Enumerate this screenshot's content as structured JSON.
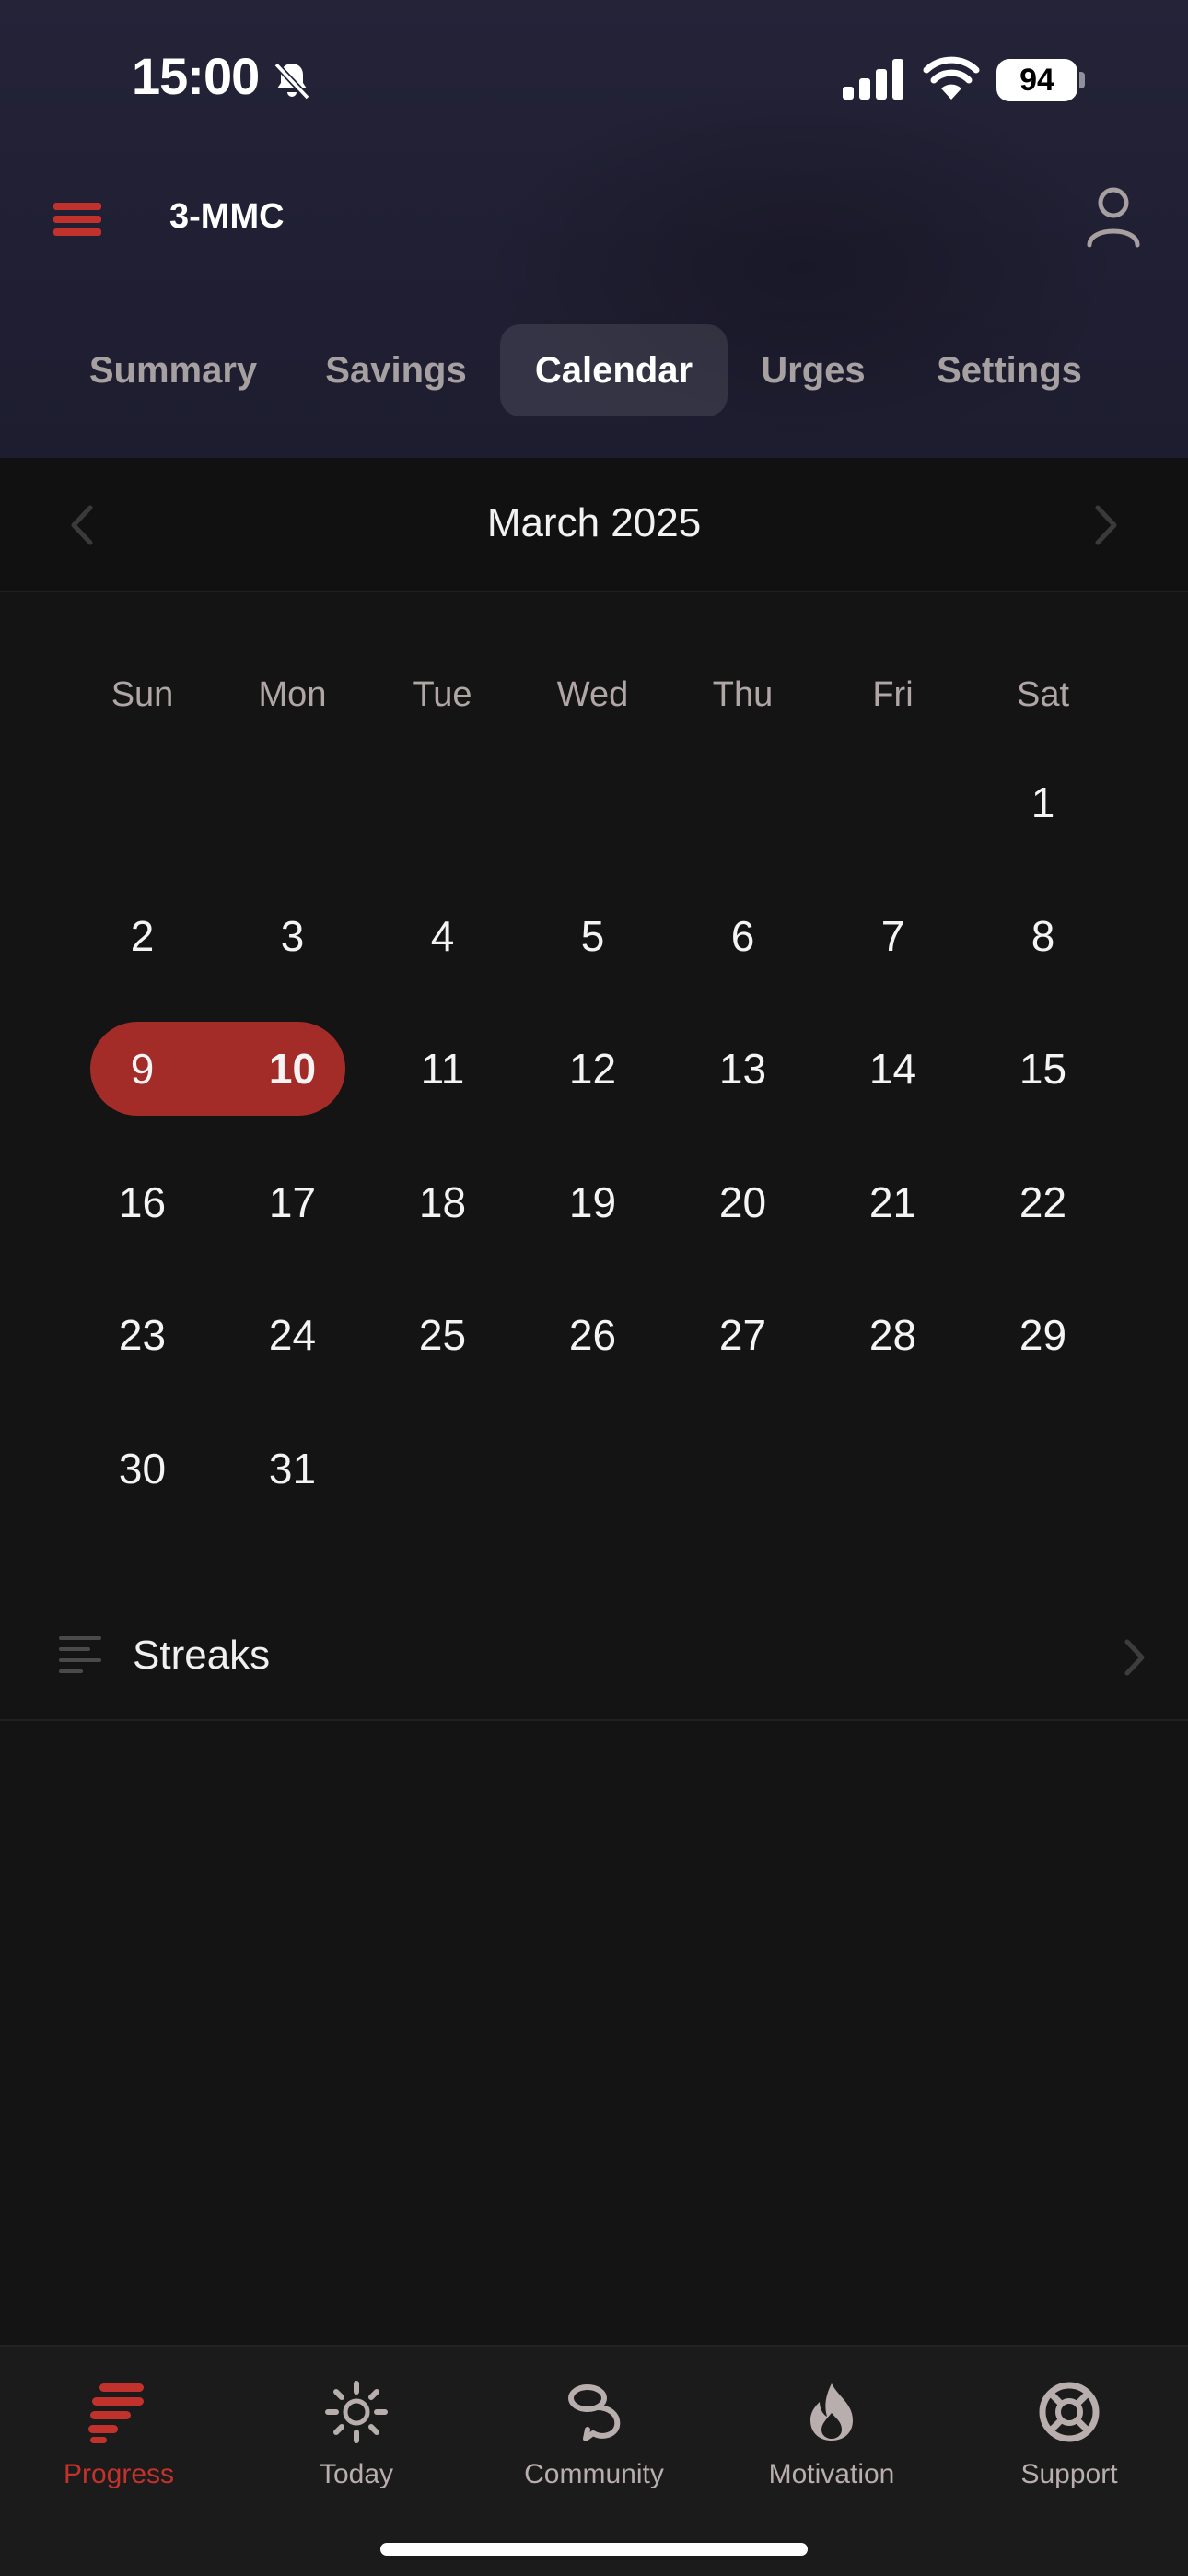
{
  "status_bar": {
    "time": "15:00",
    "battery": "94"
  },
  "header": {
    "title": "3-MMC"
  },
  "tabs": [
    {
      "label": "Summary",
      "active": false
    },
    {
      "label": "Savings",
      "active": false
    },
    {
      "label": "Calendar",
      "active": true
    },
    {
      "label": "Urges",
      "active": false
    },
    {
      "label": "Settings",
      "active": false
    }
  ],
  "calendar": {
    "month_title": "March 2025",
    "weekdays": [
      "Sun",
      "Mon",
      "Tue",
      "Wed",
      "Thu",
      "Fri",
      "Sat"
    ],
    "weeks": [
      [
        "",
        "",
        "",
        "",
        "",
        "",
        "1"
      ],
      [
        "2",
        "3",
        "4",
        "5",
        "6",
        "7",
        "8"
      ],
      [
        "9",
        "10",
        "11",
        "12",
        "13",
        "14",
        "15"
      ],
      [
        "16",
        "17",
        "18",
        "19",
        "20",
        "21",
        "22"
      ],
      [
        "23",
        "24",
        "25",
        "26",
        "27",
        "28",
        "29"
      ],
      [
        "30",
        "31",
        "",
        "",
        "",
        "",
        ""
      ]
    ],
    "highlighted_range": [
      "9",
      "10"
    ],
    "today": "10"
  },
  "streaks": {
    "label": "Streaks"
  },
  "bottom_nav": [
    {
      "label": "Progress",
      "icon": "progress-icon",
      "active": true
    },
    {
      "label": "Today",
      "icon": "sun-icon",
      "active": false
    },
    {
      "label": "Community",
      "icon": "community-icon",
      "active": false
    },
    {
      "label": "Motivation",
      "icon": "flame-icon",
      "active": false
    },
    {
      "label": "Support",
      "icon": "lifebuoy-icon",
      "active": false
    }
  ],
  "colors": {
    "accent": "#c2322d",
    "highlight": "#a32c28",
    "header_bg": "#222136",
    "page_bg": "#141414"
  }
}
